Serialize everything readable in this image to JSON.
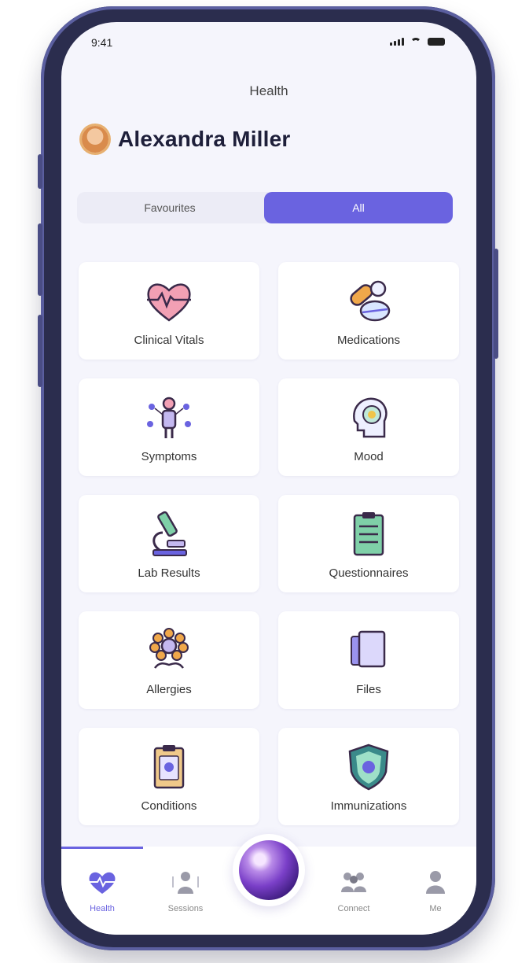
{
  "status_bar": {
    "time": "9:41"
  },
  "header": {
    "title": "Health"
  },
  "user": {
    "name": "Alexandra Miller"
  },
  "segmented_control": {
    "favourites_label": "Favourites",
    "all_label": "All",
    "selected": "All"
  },
  "categories": [
    {
      "label": "Clinical Vitals",
      "icon": "heart-pulse-icon"
    },
    {
      "label": "Medications",
      "icon": "pills-icon"
    },
    {
      "label": "Symptoms",
      "icon": "symptoms-icon"
    },
    {
      "label": "Mood",
      "icon": "mood-head-icon"
    },
    {
      "label": "Lab Results",
      "icon": "microscope-icon"
    },
    {
      "label": "Questionnaires",
      "icon": "clipboard-icon"
    },
    {
      "label": "Allergies",
      "icon": "flower-icon"
    },
    {
      "label": "Files",
      "icon": "files-icon"
    },
    {
      "label": "Conditions",
      "icon": "conditions-icon"
    },
    {
      "label": "Immunizations",
      "icon": "shield-icon"
    }
  ],
  "tab_bar": {
    "items": [
      {
        "label": "Health",
        "icon": "heart-icon",
        "active": true
      },
      {
        "label": "Sessions",
        "icon": "sessions-icon",
        "active": false
      },
      {
        "label": "",
        "icon": "assistant-orb-icon",
        "active": false
      },
      {
        "label": "Connect",
        "icon": "people-icon",
        "active": false
      },
      {
        "label": "Me",
        "icon": "person-icon",
        "active": false
      }
    ]
  },
  "colors": {
    "accent": "#6a63e0",
    "background": "#f5f5fc",
    "card": "#ffffff",
    "frame": "#2b2d4e"
  }
}
